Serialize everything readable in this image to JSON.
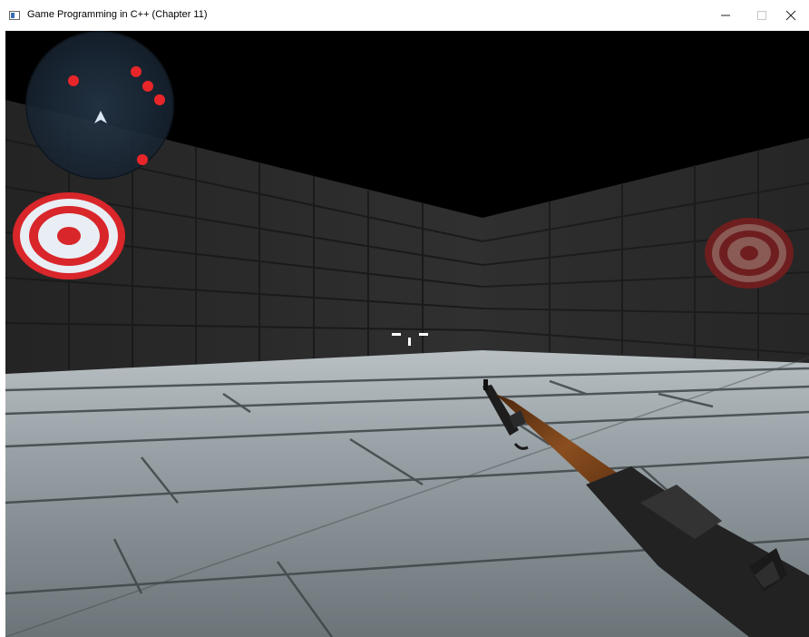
{
  "window": {
    "title": "Game Programming in C++ (Chapter 11)",
    "controls": [
      "minimize",
      "maximize",
      "close"
    ]
  },
  "icons": {
    "app": "app-window-icon",
    "minimize": "minimize-icon",
    "maximize": "maximize-icon",
    "close": "close-icon",
    "player": "player-arrow-icon",
    "crosshair": "crosshair-icon"
  },
  "hud": {
    "radar": {
      "blips": 5,
      "blip_color": "#e8262a",
      "background": "#1b2a3a"
    },
    "crosshair_color": "#ffffff"
  },
  "scene": {
    "targets": [
      {
        "name": "target-left",
        "color": "#d8262a",
        "ring_color": "#e9eef5"
      },
      {
        "name": "target-right",
        "color": "#6e1e1e",
        "ring_color": "#8a5a55"
      }
    ],
    "weapon": "rifle",
    "colors": {
      "sky": "#000000",
      "wall": "#2b2b2b",
      "floor": "#8e969a",
      "stock": "#6b3a15"
    }
  }
}
